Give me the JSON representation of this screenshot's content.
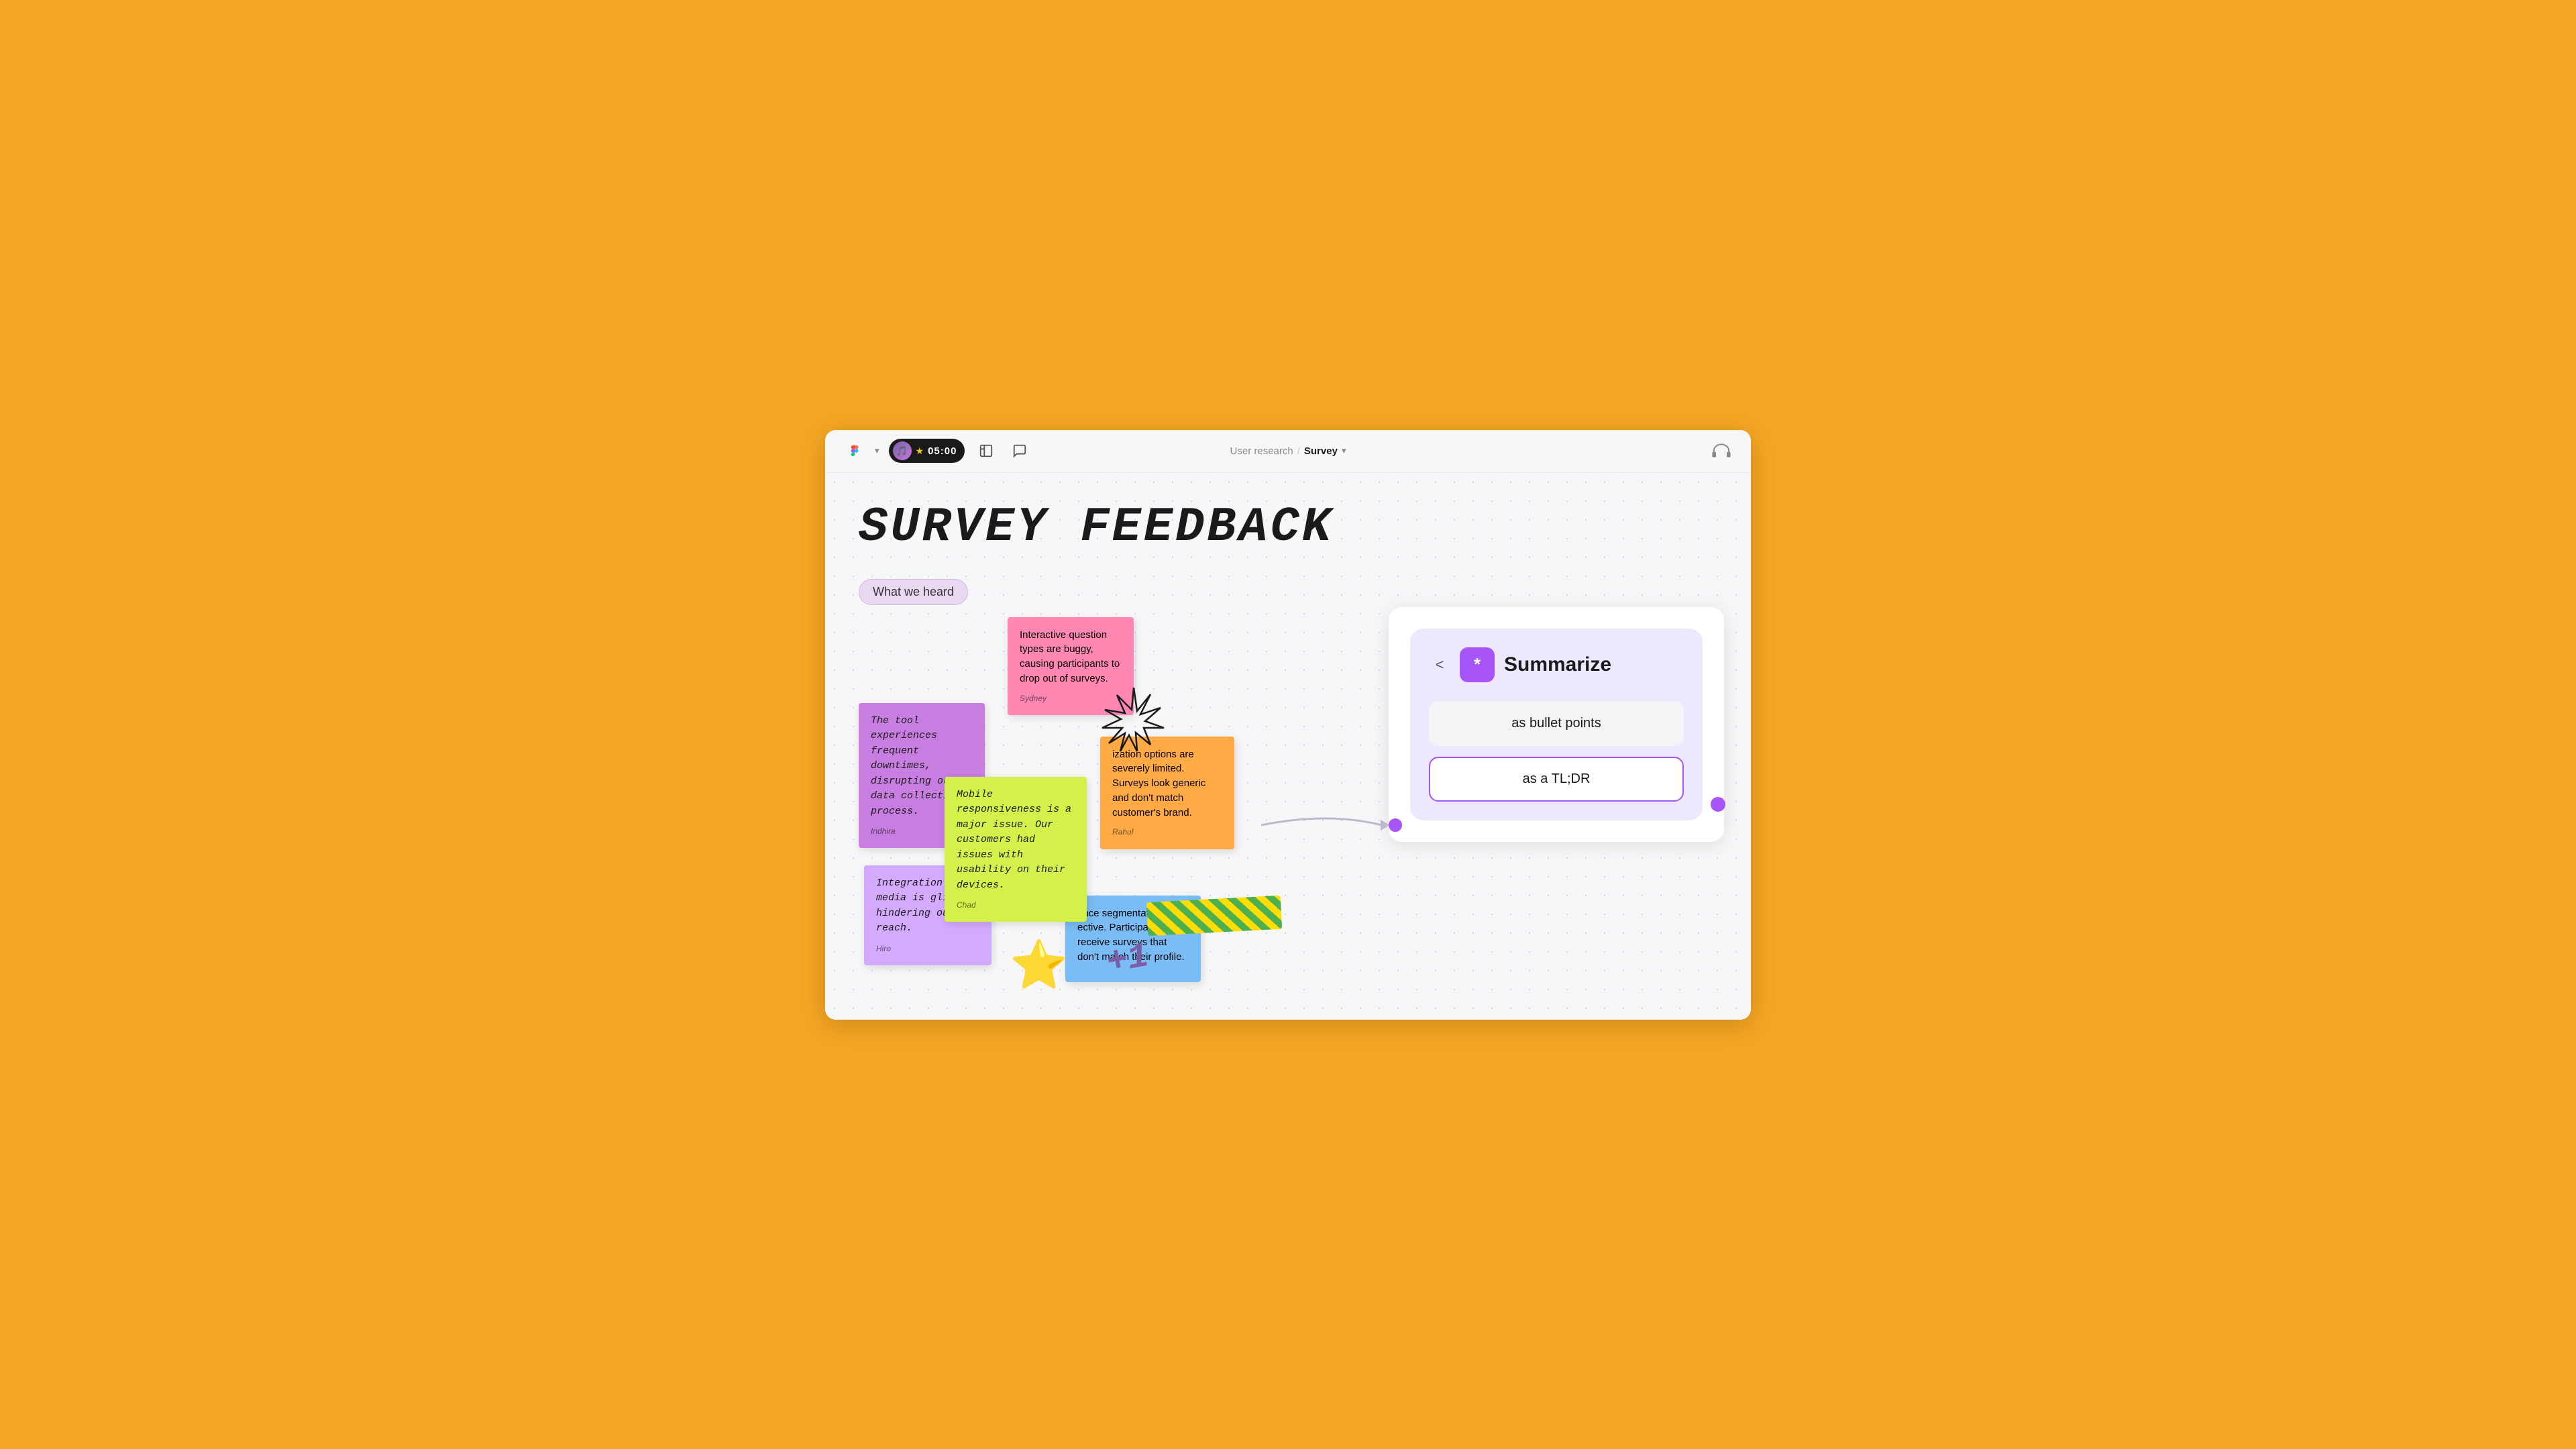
{
  "toolbar": {
    "figma_label": "Figma",
    "timer": "05:00",
    "layout_icon": "layout-icon",
    "chat_icon": "chat-icon",
    "breadcrumb_parent": "User research",
    "breadcrumb_separator": "/",
    "breadcrumb_current": "Survey",
    "headphone_icon": "headphone-icon"
  },
  "page": {
    "title": "SURVEY FEEDBACK"
  },
  "what_we_heard": {
    "label": "What we heard"
  },
  "sticky_notes": [
    {
      "id": "note1",
      "text": "Interactive question types are buggy, causing participants to drop out of surveys.",
      "author": "Sydney",
      "color": "pink",
      "style": "top:0px;left:220px;width:190px;z-index:4;"
    },
    {
      "id": "note2",
      "text": "The tool experiences frequent downtimes, disrupting our data collection process.",
      "author": "Indhira",
      "color": "purple",
      "style": "top:130px;left:0px;width:185px;z-index:3;",
      "italic": true
    },
    {
      "id": "note3",
      "text": "ization options are severely limited. Surveys look generic and don't match customer's brand.",
      "author": "Rahul",
      "color": "orange",
      "style": "top:180px;left:360px;width:200px;z-index:4;"
    },
    {
      "id": "note4",
      "text": "Mobile responsiveness is a major issue. Our customers had issues with usability on their devices.",
      "author": "Chad",
      "color": "yellow-green",
      "style": "top:240px;left:130px;width:210px;z-index:5;",
      "italic": true
    },
    {
      "id": "note5",
      "text": "Integration with media is glitch- hindering our su reach.",
      "author": "Hiro",
      "color": "light-purple",
      "style": "top:380px;left:10px;width:180px;z-index:3;",
      "italic": true
    },
    {
      "id": "note6",
      "text": "ence segmentation is ective. Participants receive surveys that don't match their profile.",
      "author": "",
      "color": "blue",
      "style": "top:420px;left:310px;width:200px;z-index:4;"
    }
  ],
  "summarize_panel": {
    "back_label": "<",
    "icon": "*",
    "title": "Summarize",
    "option1": "as bullet points",
    "option2": "as a TL;DR"
  },
  "decorations": {
    "plus_one": "+1",
    "star_emoji": "⭐"
  }
}
